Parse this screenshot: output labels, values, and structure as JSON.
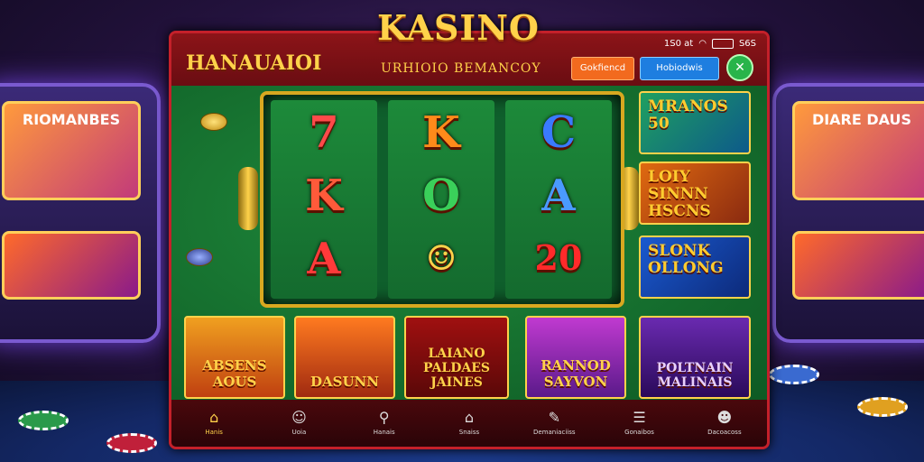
{
  "app": {
    "logo": "KASINO",
    "brand": "HANAUAIOI",
    "subtitle": "URHIOIO BEMANCOY"
  },
  "status_bar": {
    "text_left": "1S0 at",
    "text_right": "S6S"
  },
  "header_buttons": {
    "button_a": "Gokfiencd",
    "button_b": "Hobiodwis"
  },
  "reels": [
    [
      "7",
      "K",
      "A"
    ],
    [
      "K",
      "O",
      "☺"
    ],
    [
      "C",
      "A",
      "20"
    ]
  ],
  "promos": [
    {
      "text": "MRANOS 50"
    },
    {
      "text": "LOIY SINNN HSCNS"
    },
    {
      "text": "SLONK OLLONG"
    }
  ],
  "games": [
    {
      "title": "ABSENS AOUS"
    },
    {
      "title": "DASUNN"
    },
    {
      "title": "LAIANO PALDAES JAINES"
    },
    {
      "title": "RANNOD SAYVON"
    },
    {
      "title": "POLTNAIN MALINAIS"
    }
  ],
  "bg_left_screen": "RIOMANBES",
  "bg_right_screen": "DIARE DAUS",
  "nav": [
    {
      "label": "Hanis",
      "icon": "home-icon"
    },
    {
      "label": "Uoia",
      "icon": "smiley-icon"
    },
    {
      "label": "Hanais",
      "icon": "search-icon"
    },
    {
      "label": "Snaiss",
      "icon": "tower-icon"
    },
    {
      "label": "Demaniaciiss",
      "icon": "edit-icon"
    },
    {
      "label": "Gonaibos",
      "icon": "list-icon"
    },
    {
      "label": "Dacoacoss",
      "icon": "user-icon"
    }
  ],
  "colors": {
    "accent": "#ffd24a",
    "frame": "#c4202a",
    "felt": "#1f8a3c"
  }
}
